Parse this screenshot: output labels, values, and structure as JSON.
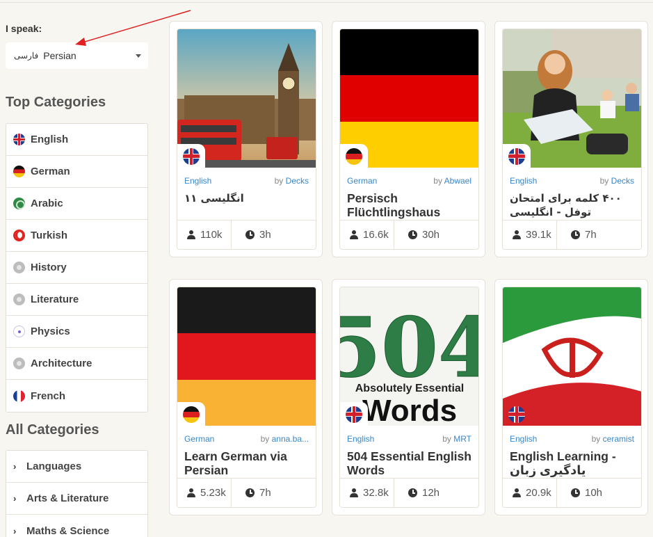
{
  "sidebar": {
    "ispeak_label": "I speak:",
    "language_select": {
      "script": "فارسی",
      "value": "Persian"
    },
    "top_categories_title": "Top Categories",
    "top_categories": [
      {
        "label": "English",
        "icon": "uk-flag-icon"
      },
      {
        "label": "German",
        "icon": "germany-flag-icon"
      },
      {
        "label": "Arabic",
        "icon": "arabic-flag-icon"
      },
      {
        "label": "Turkish",
        "icon": "turkey-flag-icon"
      },
      {
        "label": "History",
        "icon": "history-icon"
      },
      {
        "label": "Literature",
        "icon": "literature-icon"
      },
      {
        "label": "Physics",
        "icon": "atom-icon"
      },
      {
        "label": "Architecture",
        "icon": "architecture-icon"
      },
      {
        "label": "French",
        "icon": "france-flag-icon"
      }
    ],
    "all_categories_title": "All Categories",
    "all_categories": [
      {
        "label": "Languages"
      },
      {
        "label": "Arts & Literature"
      },
      {
        "label": "Maths & Science"
      }
    ]
  },
  "cards": [
    {
      "lang": "English",
      "by": "by",
      "author": "Decks",
      "title": "انگلیسی ۱۱",
      "rtl": true,
      "users": "110k",
      "time": "3h",
      "image": "big-ben-london"
    },
    {
      "lang": "German",
      "by": "by",
      "author": "Abwael",
      "title": "Persisch Flüchtlingshaus",
      "rtl": false,
      "users": "16.6k",
      "time": "30h",
      "image": "german-flag"
    },
    {
      "lang": "English",
      "by": "by",
      "author": "Decks",
      "title": "۴۰۰ کلمه برای امتحان توفل - انگلیسی",
      "rtl": true,
      "users": "39.1k",
      "time": "7h",
      "image": "students-on-lawn"
    },
    {
      "lang": "German",
      "by": "by",
      "author": "anna.ba...",
      "title": "Learn German via Persian",
      "rtl": false,
      "users": "5.23k",
      "time": "7h",
      "image": "german-flag"
    },
    {
      "lang": "English",
      "by": "by",
      "author": "MRT",
      "title": "504 Essential English Words",
      "rtl": false,
      "users": "32.8k",
      "time": "12h",
      "image": "504-book-cover"
    },
    {
      "lang": "English",
      "by": "by",
      "author": "ceramist",
      "title": "English Learning - یادگیری زبان انگلیسی",
      "rtl": false,
      "users": "20.9k",
      "time": "10h",
      "image": "iran-flag"
    }
  ],
  "cover_504": {
    "number": "504",
    "subtitle": "Absolutely Essential",
    "word": "Words"
  },
  "colors": {
    "link": "#3a86c8",
    "background": "#f8f6f1",
    "annotation_arrow": "#e02020"
  }
}
